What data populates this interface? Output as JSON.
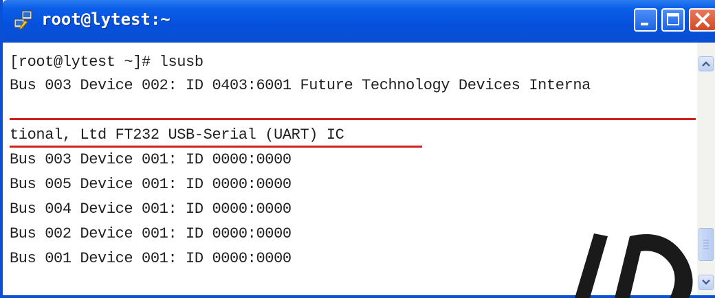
{
  "window": {
    "title": "root@lytest:~",
    "icon": "putty-terminal-icon",
    "controls": {
      "minimize": "minimize-icon",
      "maximize": "maximize-icon",
      "close": "close-icon"
    }
  },
  "terminal": {
    "lines": [
      "[root@lytest ~]# lsusb",
      "Bus 003 Device 002: ID 0403:6001 Future Technology Devices Interna",
      "tional, Ltd FT232 USB-Serial (UART) IC",
      "Bus 003 Device 001: ID 0000:0000",
      "Bus 005 Device 001: ID 0000:0000",
      "Bus 004 Device 001: ID 0000:0000",
      "Bus 002 Device 001: ID 0000:0000",
      "Bus 001 Device 001: ID 0000:0000"
    ],
    "highlight_color": "#cc1f1f"
  },
  "colors": {
    "titlebar": "#0550dc",
    "close_button": "#d04b25",
    "text": "#1f1f1f"
  }
}
